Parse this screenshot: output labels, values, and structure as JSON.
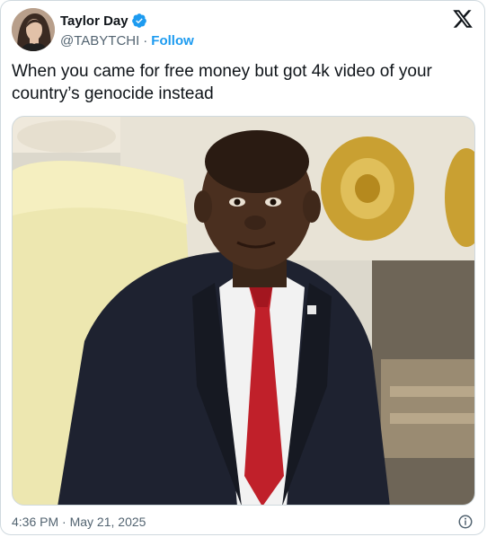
{
  "author": {
    "display_name": "Taylor Day",
    "handle": "@TABYTCHI",
    "separator": "·",
    "follow_label": "Follow",
    "verified": true
  },
  "tweet": {
    "text": "When you came for free money but got 4k video of your\ncountry’s genocide instead"
  },
  "media": {
    "type": "video-still",
    "description_icon": "video-frame"
  },
  "footer": {
    "time": "4:36 PM",
    "date": "May 21, 2025",
    "separator": "·"
  },
  "icons": {
    "brand": "x-logo-icon",
    "verified": "verified-badge-icon",
    "info": "info-icon"
  },
  "colors": {
    "accent": "#1d9bf0",
    "text": "#0f1419",
    "secondary": "#536471",
    "border": "#cfd9de"
  }
}
